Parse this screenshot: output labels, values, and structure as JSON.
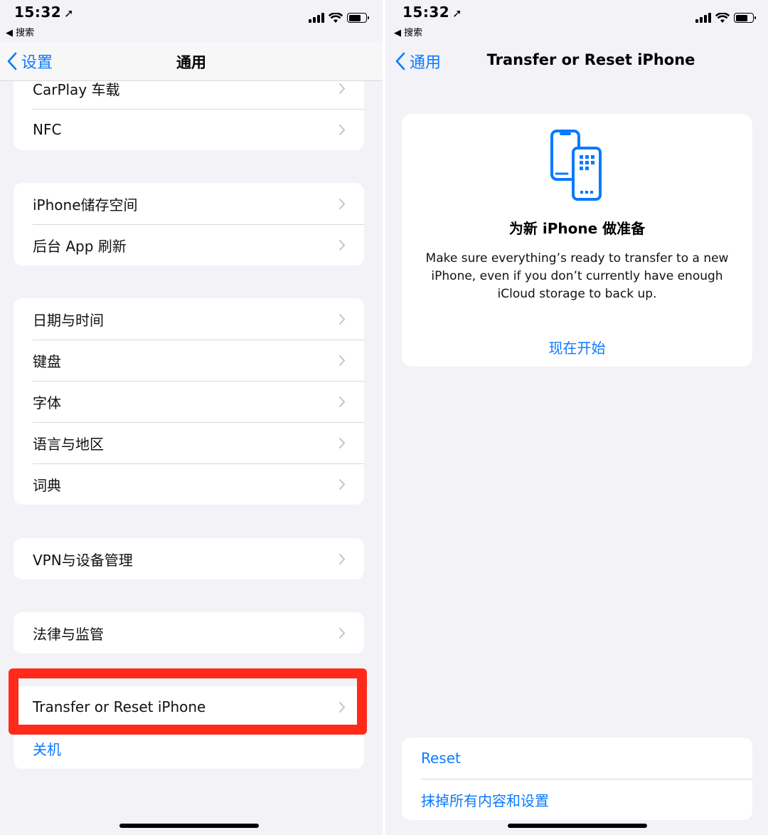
{
  "left": {
    "status": {
      "time": "15:32",
      "back_app": "◀ 搜索"
    },
    "nav": {
      "back": "设置",
      "title": "通用"
    },
    "groups": [
      {
        "items": [
          "CarPlay 车载",
          "NFC"
        ]
      },
      {
        "items": [
          "iPhone储存空间",
          "后台 App 刷新"
        ]
      },
      {
        "items": [
          "日期与时间",
          "键盘",
          "字体",
          "语言与地区",
          "词典"
        ]
      },
      {
        "items": [
          "VPN与设备管理"
        ]
      },
      {
        "items": [
          "法律与监管"
        ]
      },
      {
        "items": [
          "Transfer or Reset iPhone"
        ],
        "extra": "关机"
      }
    ]
  },
  "right": {
    "status": {
      "time": "15:32",
      "back_app": "◀ 搜索"
    },
    "nav": {
      "back": "通用",
      "title": "Transfer or Reset iPhone"
    },
    "card": {
      "title": "为新 iPhone 做准备",
      "description": "Make sure everything’s ready to transfer to a new iPhone, even if you don’t currently have enough iCloud storage to back up.",
      "action": "现在开始"
    },
    "bottom": {
      "items": [
        "Reset",
        "抹掉所有内容和设置"
      ]
    }
  },
  "colors": {
    "accent": "#0a7aff",
    "highlight": "#ff2a1a",
    "background": "#f2f2f7"
  },
  "icons": [
    "location-arrow-icon",
    "signal-icon",
    "wifi-icon",
    "battery-icon",
    "chevron-left-icon",
    "chevron-right-icon",
    "phones-transfer-icon"
  ]
}
